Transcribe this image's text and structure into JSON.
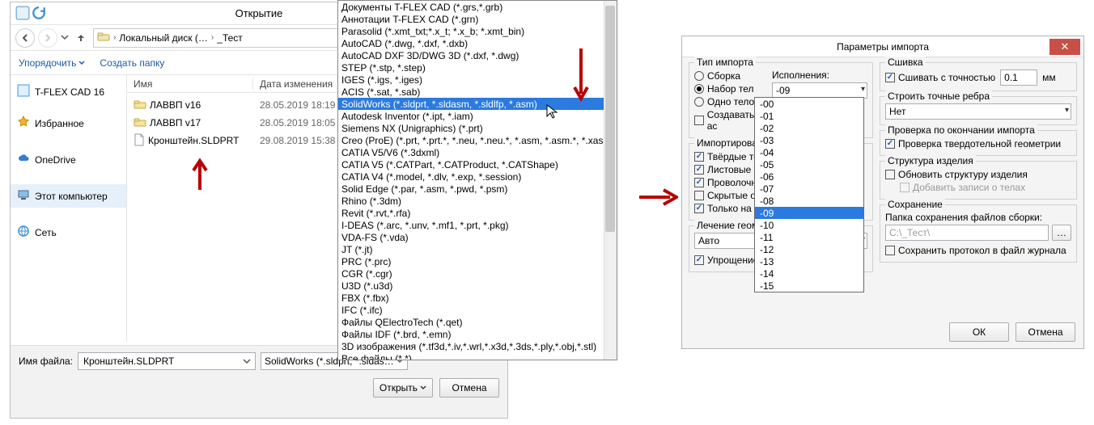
{
  "open_dialog": {
    "title": "Открытие",
    "breadcrumb": {
      "root": "Локальный диск (…",
      "folder": "_Тест"
    },
    "toolbar": {
      "organize": "Упорядочить",
      "new_folder": "Создать папку"
    },
    "sidebar": [
      {
        "label": "T-FLEX CAD 16",
        "icon": "tflex"
      },
      {
        "label": "Избранное",
        "icon": "star"
      },
      {
        "label": "OneDrive",
        "icon": "cloud"
      },
      {
        "label": "Этот компьютер",
        "icon": "pc"
      },
      {
        "label": "Сеть",
        "icon": "net"
      }
    ],
    "columns": {
      "name": "Имя",
      "date": "Дата изменения"
    },
    "files": [
      {
        "name": "ЛАВВП v16",
        "date": "28.05.2019 18:19",
        "type": "folder"
      },
      {
        "name": "ЛАВВП v17",
        "date": "28.05.2019 18:05",
        "type": "folder"
      },
      {
        "name": "Кронштейн.SLDPRT",
        "date": "29.08.2019 15:38",
        "type": "file"
      }
    ],
    "filename_label": "Имя файла:",
    "filename_value": "Кронштейн.SLDPRT",
    "filetype_value": "SolidWorks (*.sldprt, *.sldasm, *",
    "btn_open": "Открыть",
    "btn_cancel": "Отмена"
  },
  "filetypes": {
    "selected_index": 8,
    "items": [
      "Документы T-FLEX CAD (*.grs,*.grb)",
      "Аннотации T-FLEX CAD (*.grn)",
      "Parasolid (*.xmt_txt;*.x_t; *.x_b; *.xmt_bin)",
      "AutoCAD (*.dwg, *.dxf, *.dxb)",
      "AutoCAD DXF 3D/DWG 3D (*.dxf, *.dwg)",
      "STEP (*.stp, *.step)",
      "IGES (*.igs, *.iges)",
      "ACIS (*.sat, *.sab)",
      "SolidWorks (*.sldprt, *.sldasm, *.sldlfp, *.asm)",
      "Autodesk Inventor (*.ipt, *.iam)",
      "Siemens NX (Unigraphics) (*.prt)",
      "Creo (ProE) (*.prt, *.prt.*, *.neu, *.neu.*, *.asm, *.asm.*, *.xas, *.xpr)",
      "CATIA V5/V6 (*.3dxml)",
      "CATIA V5 (*.CATPart, *.CATProduct, *.CATShape)",
      "CATIA V4 (*.model, *.dlv, *.exp, *.session)",
      "Solid Edge (*.par, *.asm, *.pwd, *.psm)",
      "Rhino (*.3dm)",
      "Revit (*.rvt,*.rfa)",
      "I-DEAS (*.arc, *.unv, *.mf1, *.prt, *.pkg)",
      "VDA-FS (*.vda)",
      "JT (*.jt)",
      "PRC (*.prc)",
      "CGR (*.cgr)",
      "U3D (*.u3d)",
      "FBX (*.fbx)",
      "IFC (*.ifc)",
      "Файлы QElectroTech (*.qet)",
      "Файлы IDF (*.brd, *.emn)",
      "3D изображения (*.tf3d,*.iv,*.wrl,*.x3d,*.3ds,*.ply,*.obj,*.stl)",
      "Все файлы (*.*)"
    ]
  },
  "params": {
    "title": "Параметры импорта",
    "grp_import_type": "Тип импорта",
    "radio_assembly": "Сборка",
    "radio_bodyset": "Набор тел",
    "radio_onebody": "Одно тело",
    "chk_create_as": "Создавать ас",
    "exec_label": "Исполнения:",
    "exec_value": "-09",
    "grp_import_obj": "Импортировать о",
    "chk_solids": "Твёрдые тела",
    "chk_sheets": "Листовые тел",
    "chk_wires": "Проволочные",
    "chk_hidden": "Скрытые объ",
    "chk_active_only": "Только на акт",
    "grp_heal": "Лечение геометр",
    "heal_value": "Авто",
    "chk_simplify": "Упрощение геометрии",
    "grp_sew": "Сшивка",
    "chk_sew": "Сшивать с точностью",
    "sew_value": "0.1",
    "sew_unit": "мм",
    "grp_edges": "Строить точные ребра",
    "edges_value": "Нет",
    "grp_check": "Проверка по окончании импорта",
    "chk_check_geom": "Проверка твердотельной геометрии",
    "grp_struct": "Структура изделия",
    "chk_update_struct": "Обновить структуру изделия",
    "chk_add_body_records": "Добавить записи о телах",
    "grp_save": "Сохранение",
    "save_path_label": "Папка сохранения файлов сборки:",
    "save_path_value": "C:\\_Тест\\",
    "chk_save_log": "Сохранить протокол в файл журнала",
    "btn_ok": "ОК",
    "btn_cancel": "Отмена"
  },
  "exec_options": {
    "selected_index": 9,
    "items": [
      "-00",
      "-01",
      "-02",
      "-03",
      "-04",
      "-05",
      "-06",
      "-07",
      "-08",
      "-09",
      "-10",
      "-11",
      "-12",
      "-13",
      "-14",
      "-15"
    ]
  }
}
